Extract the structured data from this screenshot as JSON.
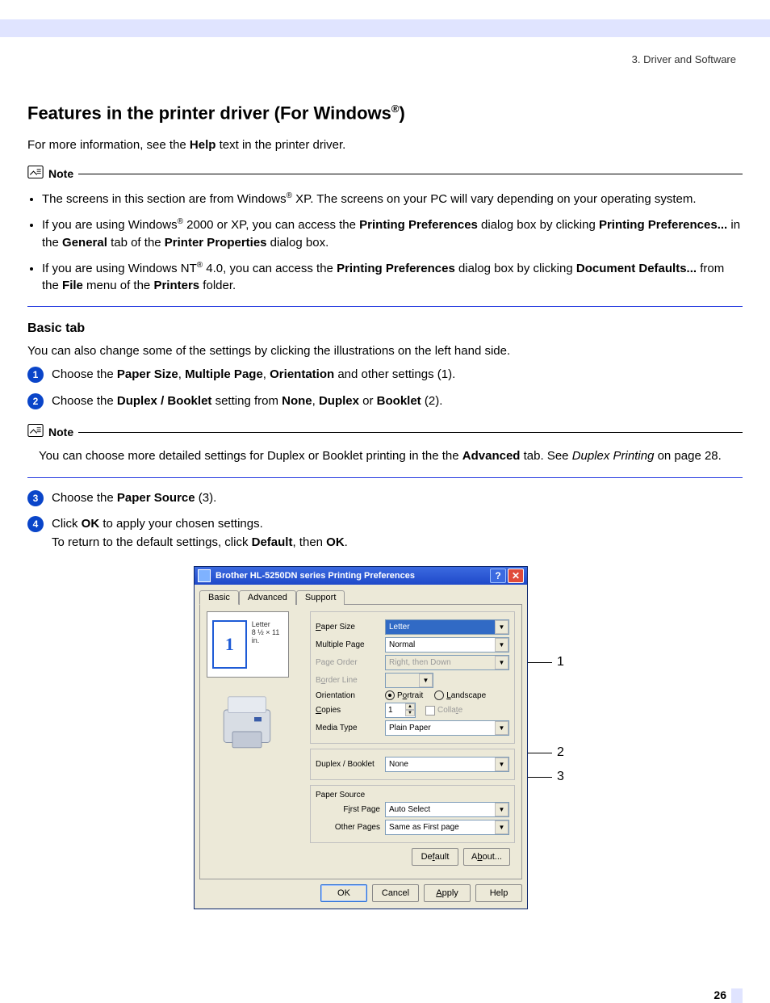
{
  "breadcrumb": "3. Driver and Software",
  "h1_pre": "Features in the printer driver (For Windows",
  "h1_post": ")",
  "reg": "®",
  "intro_a": "For more information, see the ",
  "intro_b": "Help",
  "intro_c": " text in the printer driver.",
  "note_label": "Note",
  "note1": {
    "li1_a": "The screens in this section are from Windows",
    "li1_b": " XP. The screens on your PC will vary depending on your operating system.",
    "li2_a": "If you are using Windows",
    "li2_b": " 2000 or XP, you can access the ",
    "li2_c": "Printing Preferences",
    "li2_d": " dialog box by clicking ",
    "li2_e": "Printing Preferences...",
    "li2_f": " in the ",
    "li2_g": "General",
    "li2_h": " tab of the ",
    "li2_i": "Printer Properties",
    "li2_j": " dialog box.",
    "li3_a": "If you are using Windows NT",
    "li3_b": " 4.0, you can access the ",
    "li3_c": "Printing Preferences",
    "li3_d": " dialog box by clicking ",
    "li3_e": "Document Defaults...",
    "li3_f": " from the ",
    "li3_g": "File",
    "li3_h": " menu of the ",
    "li3_i": "Printers",
    "li3_j": " folder."
  },
  "h2": "Basic tab",
  "h2_sub": "You can also change some of the settings by clicking the illustrations on the left hand side.",
  "steps": {
    "n1": "1",
    "n2": "2",
    "n3": "3",
    "n4": "4",
    "s1_a": "Choose the ",
    "s1_b": "Paper Size",
    "s1_c": ", ",
    "s1_d": "Multiple Page",
    "s1_e": ", ",
    "s1_f": "Orientation",
    "s1_g": " and other settings (1).",
    "s2_a": "Choose the ",
    "s2_b": "Duplex / Booklet",
    "s2_c": " setting from ",
    "s2_d": "None",
    "s2_e": ", ",
    "s2_f": "Duplex",
    "s2_g": " or ",
    "s2_h": "Booklet",
    "s2_i": " (2).",
    "s3_a": "Choose the ",
    "s3_b": "Paper Source",
    "s3_c": " (3).",
    "s4_a": "Click ",
    "s4_b": "OK",
    "s4_c": " to apply your chosen settings.",
    "s4_d": "To return to the default settings, click ",
    "s4_e": "Default",
    "s4_f": ", then ",
    "s4_g": "OK",
    "s4_h": "."
  },
  "note2_a": "You can choose more detailed settings for Duplex or Booklet printing in the the ",
  "note2_b": "Advanced",
  "note2_c": " tab. See ",
  "note2_d": "Duplex Printing",
  "note2_e": " on page 28.",
  "dialog": {
    "title": "Brother HL-5250DN series Printing Preferences",
    "help": "?",
    "close": "✕",
    "tabs": {
      "basic": "Basic",
      "advanced": "Advanced",
      "support": "Support"
    },
    "preview": {
      "num": "1",
      "meta1": "Letter",
      "meta2": "8 ½ × 11 in."
    },
    "labels": {
      "paper_size": "Paper Size",
      "multiple_page": "Multiple Page",
      "page_order": "Page Order",
      "border_line": "Border Line",
      "orientation": "Orientation",
      "copies": "Copies",
      "media_type": "Media Type",
      "duplex": "Duplex / Booklet",
      "paper_source": "Paper Source",
      "first_page": "First Page",
      "other_pages": "Other Pages"
    },
    "values": {
      "paper_size": "Letter",
      "multiple_page": "Normal",
      "page_order": "Right, then Down",
      "portrait": "Portrait",
      "landscape": "Landscape",
      "copies": "1",
      "collate": "Collate",
      "media_type": "Plain Paper",
      "duplex": "None",
      "first_page": "Auto Select",
      "other_pages": "Same as First page"
    },
    "buttons": {
      "default": "Default",
      "about": "About...",
      "ok": "OK",
      "cancel": "Cancel",
      "apply": "Apply",
      "help": "Help"
    }
  },
  "callouts": {
    "c1": "1",
    "c2": "2",
    "c3": "3"
  },
  "page_number": "26"
}
